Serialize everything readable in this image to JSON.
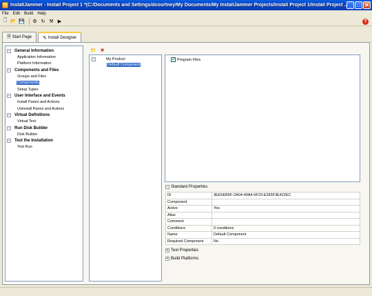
{
  "window": {
    "title": "InstallJammer - Install Project 1 *(C:/Documents and Settings/dcourtney/My Documents/My InstallJammer Projects/Install Project 1/Install Project ...",
    "min_glyph": "_",
    "max_glyph": "□",
    "close_glyph": "✕"
  },
  "menu": {
    "items": [
      "File",
      "Edit",
      "Build",
      "Help"
    ]
  },
  "toolbar": {
    "icons": [
      "new-file-icon",
      "open-folder-icon",
      "save-icon",
      "build-icon",
      "refresh-icon",
      "settings-icon",
      "run-icon"
    ],
    "glyphs": [
      "🗋",
      "📂",
      "💾",
      "⚙",
      "↻",
      "⚒",
      "▶"
    ],
    "help_glyph": "?"
  },
  "tabs": [
    {
      "label": "Start Page",
      "icon": "start-page-icon",
      "glyph": "🗎"
    },
    {
      "label": "Install Designer",
      "icon": "install-designer-icon",
      "glyph": "✎"
    }
  ],
  "nav": {
    "groups": [
      {
        "label": "General Information",
        "items": [
          "Application Information",
          "Platform Information"
        ]
      },
      {
        "label": "Components and Files",
        "items": [
          "Groups and Files",
          "Components",
          "Setup Types"
        ]
      },
      {
        "label": "User Interface and Events",
        "items": [
          "Install Panes and Actions",
          "Uninstall Panes and Actions"
        ]
      },
      {
        "label": "Virtual Definitions",
        "items": [
          "Virtual Text"
        ]
      },
      {
        "label": "Run Disk Builder",
        "items": [
          "Disk Builder"
        ]
      },
      {
        "label": "Test the Installation",
        "items": [
          "Test Run"
        ]
      }
    ],
    "selected": "Components",
    "expander_glyph": "−"
  },
  "component_toolbar": {
    "add_glyph": "📁",
    "delete_glyph": "✖"
  },
  "tree": {
    "root": "My Product",
    "child": "Default Component",
    "root_expander": "−"
  },
  "files": {
    "items": [
      {
        "label": "Program Files",
        "checked": true
      }
    ],
    "check_glyph": "✓"
  },
  "properties": {
    "standard_header": "Standard Properties",
    "rows": [
      {
        "key": "ID",
        "value": "3EE5EB5F-2A04-49A4-9F23-E283F3E422EC"
      },
      {
        "key": "Component",
        "value": ""
      },
      {
        "key": "Active",
        "value": "Yes"
      },
      {
        "key": "Alias",
        "value": ""
      },
      {
        "key": "Comment",
        "value": ""
      },
      {
        "key": "Conditions",
        "value": "0 conditions"
      },
      {
        "key": "Name",
        "value": "Default Component"
      },
      {
        "key": "Required Component",
        "value": "No"
      }
    ],
    "text_header": "Text Properties",
    "build_header": "Build Platforms",
    "collapse_glyph": "−",
    "expand_glyph": "+"
  }
}
